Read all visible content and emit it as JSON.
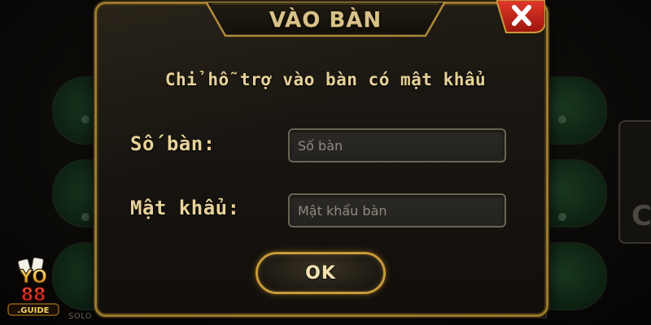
{
  "background": {
    "table_label": "SOLO",
    "side_char": "C"
  },
  "logo": {
    "brand_top": "YO",
    "brand_mid": "88",
    "brand_bottom": ".GUIDE"
  },
  "dialog": {
    "title": "VÀO BÀN",
    "close_icon": "close-x-icon",
    "subtitle": "Chỉ hỗ trợ vào bàn có mật khẩu",
    "table_label": "Số bàn:",
    "table_placeholder": "Số bàn",
    "table_value": "",
    "password_label": "Mật khẩu:",
    "password_placeholder": "Mật khẩu bàn",
    "password_value": "",
    "ok_label": "OK"
  },
  "colors": {
    "gold": "#c89a3a",
    "gold_text": "#e8d29a",
    "close_red": "#c8281e",
    "panel_bg": "#171410"
  }
}
